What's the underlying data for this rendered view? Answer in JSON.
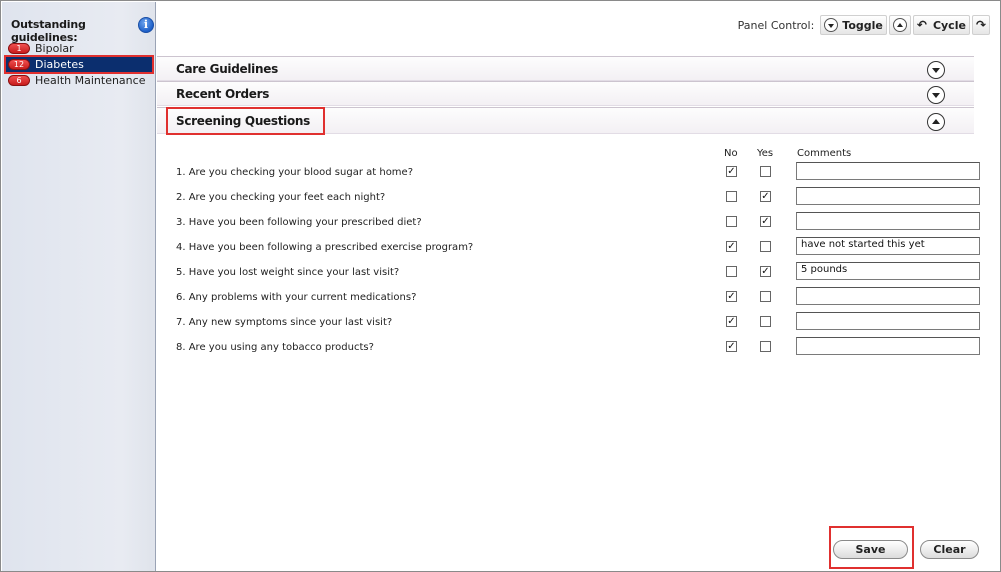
{
  "sidebar": {
    "title": "Outstanding guidelines:",
    "info_icon": "info-icon",
    "items": [
      {
        "badge": "1",
        "label": "Bipolar",
        "selected": false
      },
      {
        "badge": "12",
        "label": "Diabetes",
        "selected": true
      },
      {
        "badge": "6",
        "label": "Health Maintenance",
        "selected": false
      }
    ]
  },
  "panel_control": {
    "label": "Panel Control:",
    "toggle_label": "Toggle",
    "cycle_label": "Cycle"
  },
  "sections": [
    {
      "title": "Care Guidelines",
      "expanded": false
    },
    {
      "title": "Recent Orders",
      "expanded": false
    },
    {
      "title": "Screening Questions",
      "expanded": true
    }
  ],
  "screening": {
    "headers": {
      "no": "No",
      "yes": "Yes",
      "comments": "Comments"
    },
    "questions": [
      {
        "text": "1. Are you checking your blood sugar at home?",
        "no": true,
        "yes": false,
        "comment": ""
      },
      {
        "text": "2. Are you checking your feet each night?",
        "no": false,
        "yes": true,
        "comment": ""
      },
      {
        "text": "3. Have you been following your prescribed diet?",
        "no": false,
        "yes": true,
        "comment": ""
      },
      {
        "text": "4. Have you been following a prescribed exercise program?",
        "no": true,
        "yes": false,
        "comment": "have not started this yet"
      },
      {
        "text": "5. Have you lost weight since your last visit?",
        "no": false,
        "yes": true,
        "comment": "5 pounds"
      },
      {
        "text": "6. Any problems with your current medications?",
        "no": true,
        "yes": false,
        "comment": ""
      },
      {
        "text": "7. Any new symptoms since your last visit?",
        "no": true,
        "yes": false,
        "comment": ""
      },
      {
        "text": "8. Are you using any tobacco products?",
        "no": true,
        "yes": false,
        "comment": ""
      }
    ]
  },
  "footer": {
    "save_label": "Save",
    "clear_label": "Clear"
  },
  "colors": {
    "selected_bg": "#0b2e6e",
    "highlight": "#e0302f",
    "badge": "#d02020"
  }
}
